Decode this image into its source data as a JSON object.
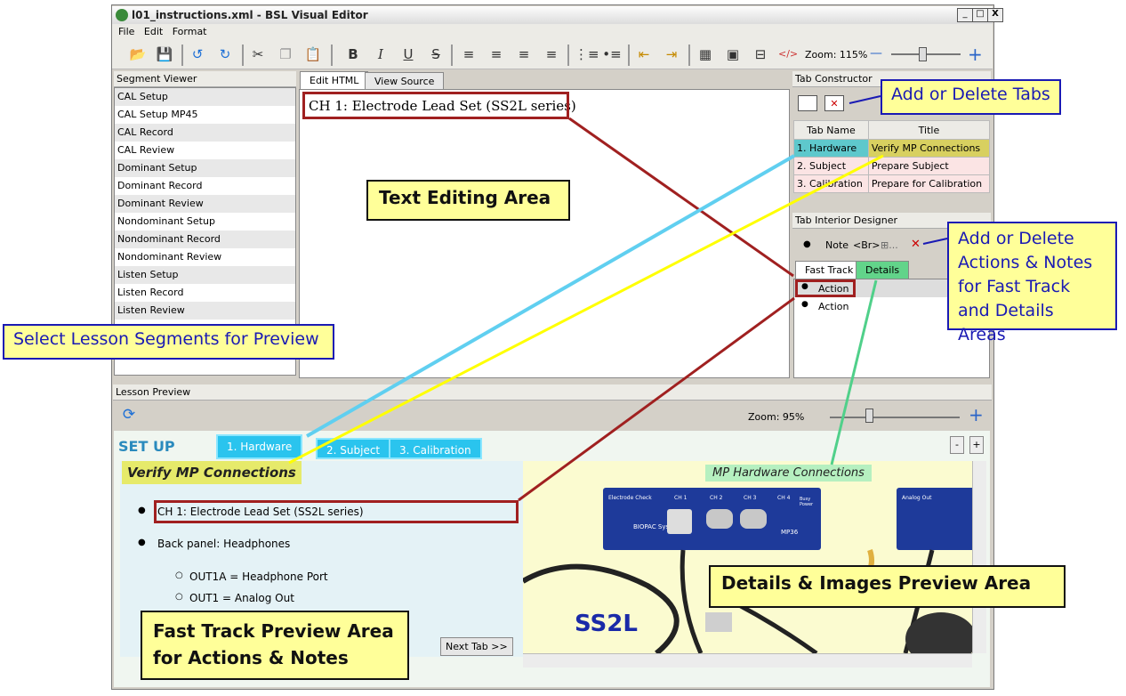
{
  "window": {
    "title": "l01_instructions.xml - BSL Visual Editor",
    "min": "_",
    "max": "□",
    "close": "X"
  },
  "menu": [
    "File",
    "Edit",
    "Format"
  ],
  "toolbar": {
    "bold": "B",
    "italic": "I",
    "underline": "U",
    "strike": "S",
    "zoom_label": "Zoom: 115%",
    "zoom_minus": "—",
    "zoom_plus": "+",
    "zoom_level": 0.45
  },
  "segment_viewer": {
    "title": "Segment Viewer",
    "items": [
      "CAL Setup",
      "CAL Setup MP45",
      "CAL Record",
      "CAL Review",
      "Dominant Setup",
      "Dominant Record",
      "Dominant Review",
      "Nondominant Setup",
      "Nondominant Record",
      "Nondominant Review",
      "Listen Setup",
      "Listen Record",
      "Listen Review"
    ]
  },
  "editor": {
    "tabs": [
      "Edit HTML",
      "View Source"
    ],
    "content": "CH 1: Electrode Lead Set (SS2L series)"
  },
  "tab_constructor": {
    "title": "Tab Constructor",
    "col_name": "Tab Name",
    "col_title": "Title",
    "rows": [
      {
        "name": "1. Hardware",
        "title": "Verify MP Connections"
      },
      {
        "name": "2. Subject",
        "title": "Prepare Subject"
      },
      {
        "name": "3. Calibration",
        "title": "Prepare for Calibration"
      }
    ]
  },
  "tab_interior": {
    "title": "Tab Interior Designer",
    "tools": {
      "note": "Note",
      "br": "<Br>",
      "more": "⊞..."
    },
    "tabs": [
      "Fast Track",
      "Details"
    ],
    "actions": [
      "Action",
      "Action"
    ]
  },
  "lesson_preview": {
    "title": "Lesson Preview",
    "zoom_label": "Zoom: 95%",
    "zoom_level": 0.3,
    "heading": "SET UP",
    "tabs": [
      "1. Hardware",
      "2. Subject",
      "3. Calibration"
    ],
    "collapse": "-",
    "expand": "+",
    "page_title": "Verify MP Connections",
    "bullets": [
      "CH 1: Electrode Lead Set (SS2L series)",
      "Back panel: Headphones"
    ],
    "sub_bullets": [
      "OUT1A = Headphone Port",
      "OUT1 = Analog Out"
    ],
    "next_tab": "Next Tab >>",
    "details_caption": "MP Hardware Connections",
    "device_label": "BIOPAC Systems",
    "device_model": "MP36",
    "electrode_check": "Electrode Check",
    "channels": [
      "CH 1",
      "CH 2",
      "CH 3",
      "CH 4"
    ],
    "busy_power": "Busy Power",
    "analog_out": "Analog Out",
    "cable_label": "SS2L"
  },
  "callouts": {
    "tabs": "Add or Delete Tabs",
    "text_area": "Text Editing Area",
    "segments": "Select Lesson Segments for Preview",
    "actions_notes": [
      "Add or Delete",
      "Actions & Notes",
      "for Fast Track",
      "and Details Areas"
    ],
    "details_area": "Details & Images Preview Area",
    "fast_track": [
      "Fast Track Preview Area",
      "for Actions & Notes"
    ]
  },
  "colors": {
    "callout_fill": "#ffff99",
    "callout_border": "#1a1ab4",
    "cyan_tab": "#2ac4ee",
    "red_box": "#a02020"
  }
}
